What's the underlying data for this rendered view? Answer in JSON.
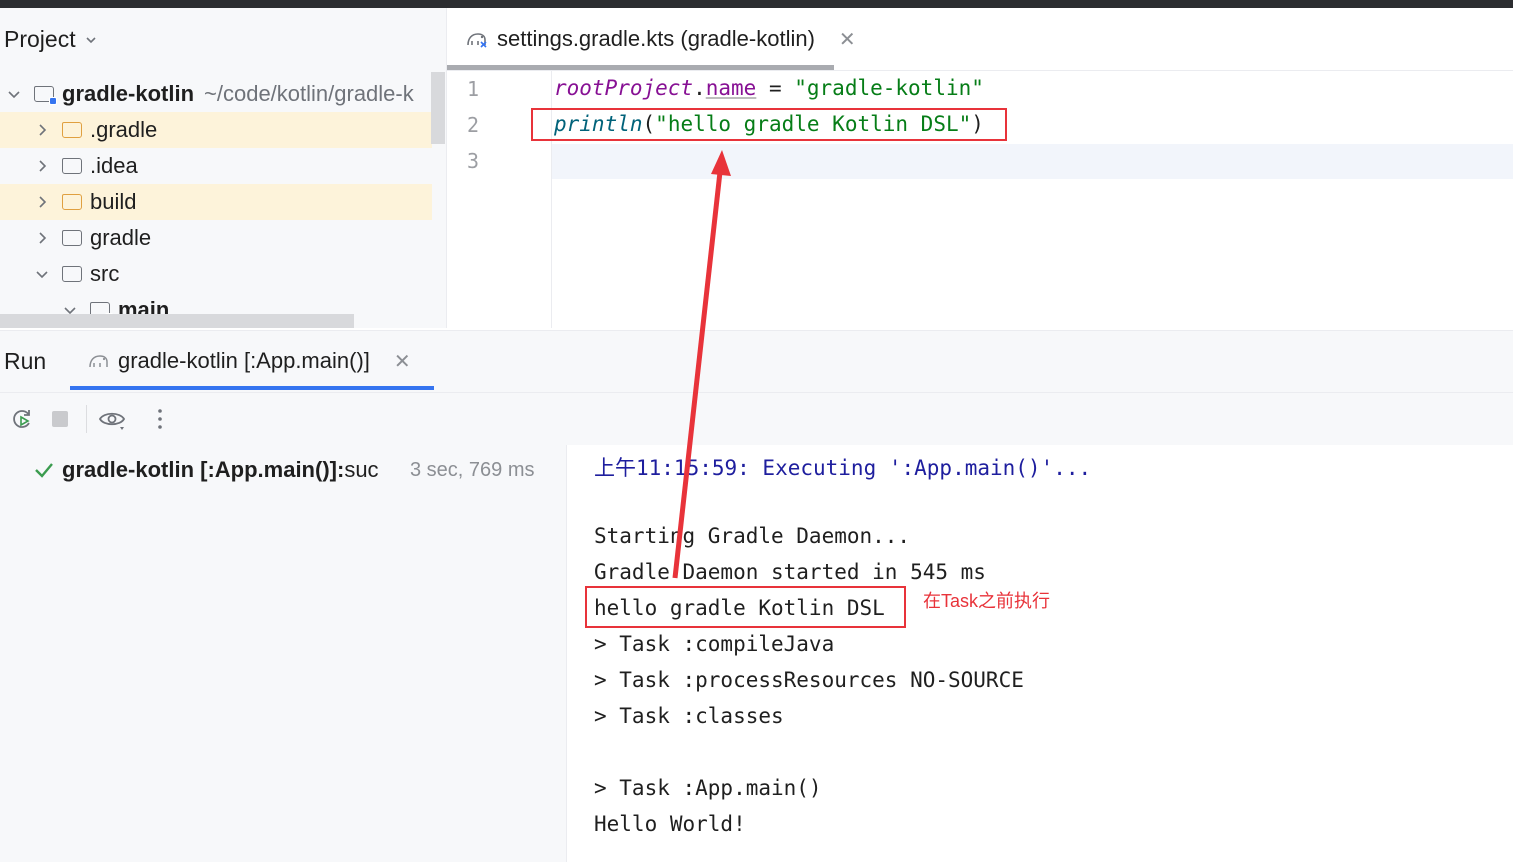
{
  "project_panel": {
    "title": "Project",
    "root": {
      "name": "gradle-kotlin",
      "path": "~/code/kotlin/gradle-k"
    },
    "items": [
      {
        "label": ".gradle"
      },
      {
        "label": ".idea"
      },
      {
        "label": "build"
      },
      {
        "label": "gradle"
      },
      {
        "label": "src"
      },
      {
        "label": "main"
      }
    ]
  },
  "editor": {
    "tab_label": "settings.gradle.kts (gradle-kotlin)",
    "line_numbers": [
      "1",
      "2",
      "3"
    ],
    "line1": {
      "receiver": "rootProject",
      "dot": ".",
      "property": "name",
      "op": " = ",
      "value": "\"gradle-kotlin\""
    },
    "line2": {
      "func": "println",
      "open": "(",
      "arg": "\"hello gradle Kotlin DSL\"",
      "close": ")"
    }
  },
  "run_panel": {
    "label": "Run",
    "tab_label": "gradle-kotlin [:App.main()]",
    "tree_item": {
      "name": "gradle-kotlin [:App.main()]:",
      "status": " suc",
      "time": "3 sec, 769 ms"
    },
    "console_lines": [
      "上午11:15:59: Executing ':App.main()'...",
      "",
      "Starting Gradle Daemon...",
      "Gradle Daemon started in 545 ms",
      "hello gradle Kotlin DSL",
      "> Task :compileJava",
      "> Task :processResources NO-SOURCE",
      "> Task :classes",
      "",
      "> Task :App.main()",
      "Hello World!"
    ],
    "annotation": "在Task之前执行"
  },
  "colors": {
    "accent": "#3574f0",
    "annotation_red": "#e8333a",
    "success_green": "#3b9c4f"
  }
}
